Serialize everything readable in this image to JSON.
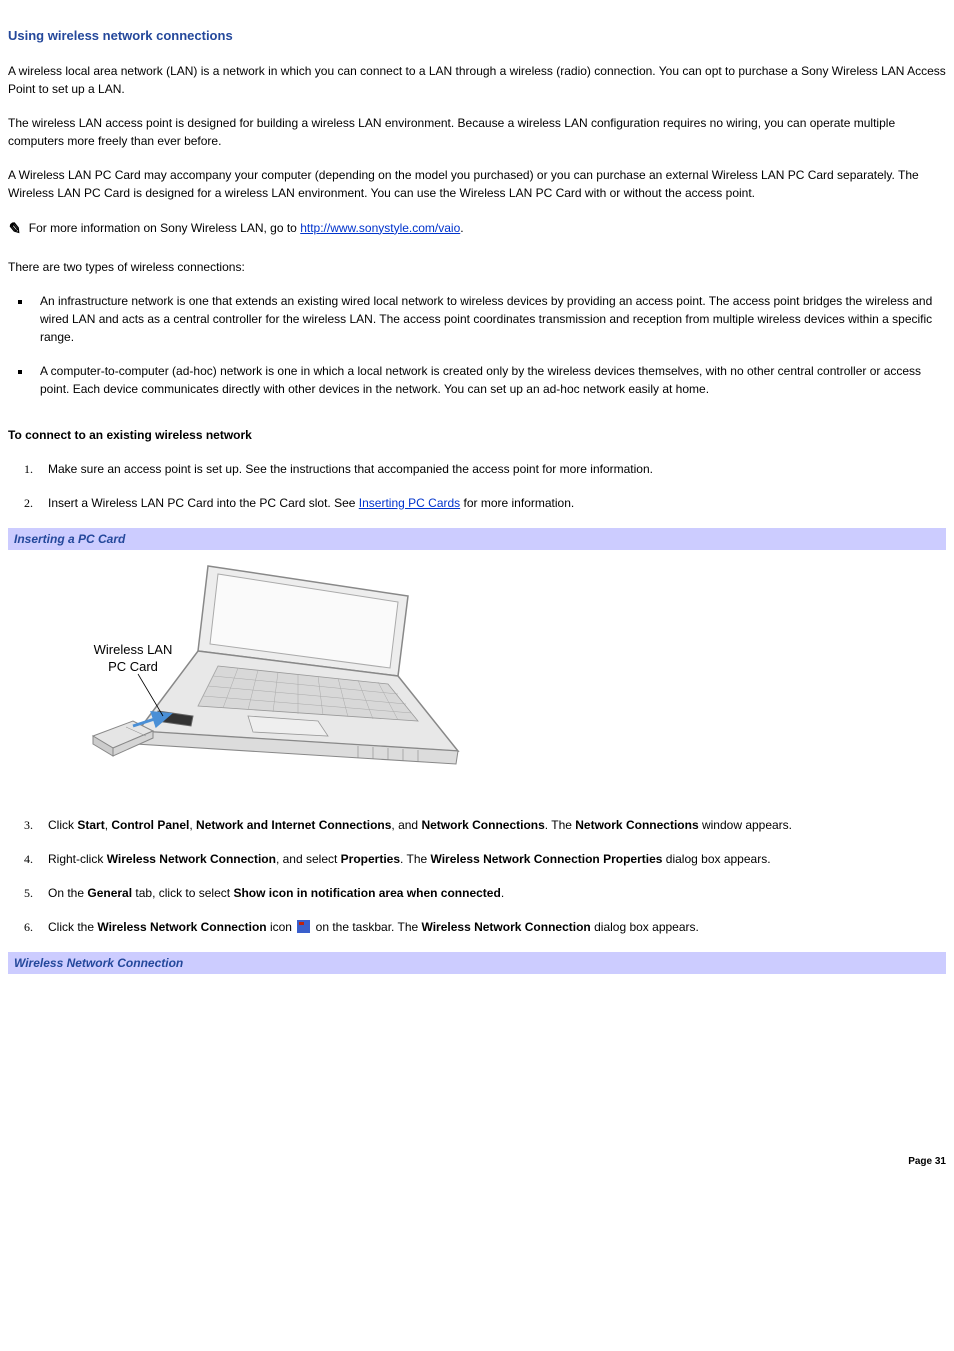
{
  "heading": "Using wireless network connections",
  "p1": "A wireless local area network (LAN) is a network in which you can connect to a LAN through a wireless (radio) connection. You can opt to purchase a Sony Wireless LAN Access Point to set up a LAN.",
  "p2": "The wireless LAN access point is designed for building a wireless LAN environment. Because a wireless LAN configuration requires no wiring, you can operate multiple computers more freely than ever before.",
  "p3": "A Wireless LAN PC Card may accompany your computer (depending on the model you purchased) or you can purchase an external Wireless LAN PC Card separately. The Wireless LAN PC Card is designed for a wireless LAN environment. You can use the Wireless LAN PC Card with or without the access point.",
  "note_prefix": "For more information on Sony Wireless LAN, go to ",
  "note_link": "http://www.sonystyle.com/vaio",
  "note_suffix": ".",
  "p4": "There are two types of wireless connections:",
  "bullets": [
    "An infrastructure network is one that extends an existing wired local network to wireless devices by providing an access point. The access point bridges the wireless and wired LAN and acts as a central controller for the wireless LAN. The access point coordinates transmission and reception from multiple wireless devices within a specific range.",
    "A computer-to-computer (ad-hoc) network is one in which a local network is created only by the wireless devices themselves, with no other central controller or access point. Each device communicates directly with other devices in the network. You can set up an ad-hoc network easily at home."
  ],
  "sub_heading": "To connect to an existing wireless network",
  "steps": {
    "s1": "Make sure an access point is set up. See the instructions that accompanied the access point for more information.",
    "s2_prefix": "Insert a Wireless LAN PC Card into the PC Card slot. See ",
    "s2_link": "Inserting PC Cards",
    "s2_suffix": " for more information.",
    "s3": {
      "t1": "Click ",
      "b1": "Start",
      "t2": ", ",
      "b2": "Control Panel",
      "t3": ", ",
      "b3": "Network and Internet Connections",
      "t4": ", and ",
      "b4": "Network Connections",
      "t5": ". The ",
      "b5": "Network Connections",
      "t6": " window appears."
    },
    "s4": {
      "t1": "Right-click ",
      "b1": "Wireless Network Connection",
      "t2": ", and select ",
      "b2": "Properties",
      "t3": ". The ",
      "b3": "Wireless Network Connection Properties",
      "t4": " dialog box appears."
    },
    "s5": {
      "t1": "On the ",
      "b1": "General",
      "t2": " tab, click to select ",
      "b2": "Show icon in notification area when connected",
      "t3": "."
    },
    "s6": {
      "t1": "Click the ",
      "b1": "Wireless Network Connection",
      "t2": " icon ",
      "t3": " on the taskbar. The ",
      "b2": "Wireless Network Connection",
      "t4": " dialog box appears."
    }
  },
  "fig1_caption": "Inserting a PC Card",
  "fig1_label1": "Wireless LAN",
  "fig1_label2": "PC Card",
  "fig2_caption": "Wireless Network Connection",
  "page_label": "Page 31"
}
